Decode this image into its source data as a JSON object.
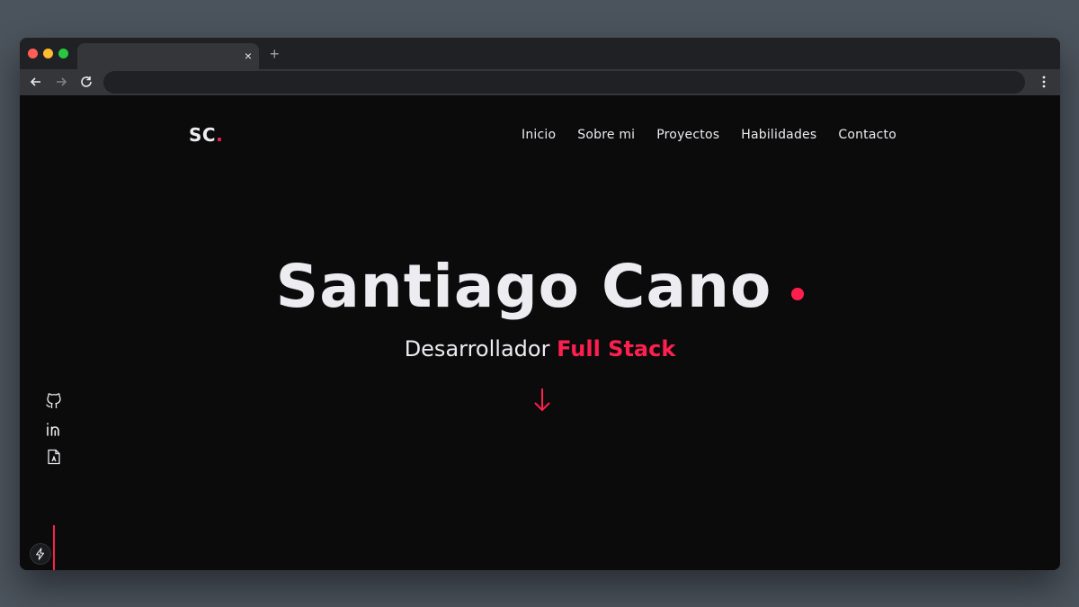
{
  "browser": {
    "tab_close": "×",
    "new_tab": "+",
    "address": ""
  },
  "site": {
    "logo_text": "SC",
    "logo_dot": ".",
    "nav": [
      "Inicio",
      "Sobre mi",
      "Proyectos",
      "Habilidades",
      "Contacto"
    ],
    "hero_name": "Santiago Cano",
    "subtitle_plain": "Desarrollador ",
    "subtitle_accent": "Full Stack",
    "accent_color": "#ff1f4f",
    "socials": [
      "github-icon",
      "linkedin-icon",
      "resume-icon"
    ]
  }
}
